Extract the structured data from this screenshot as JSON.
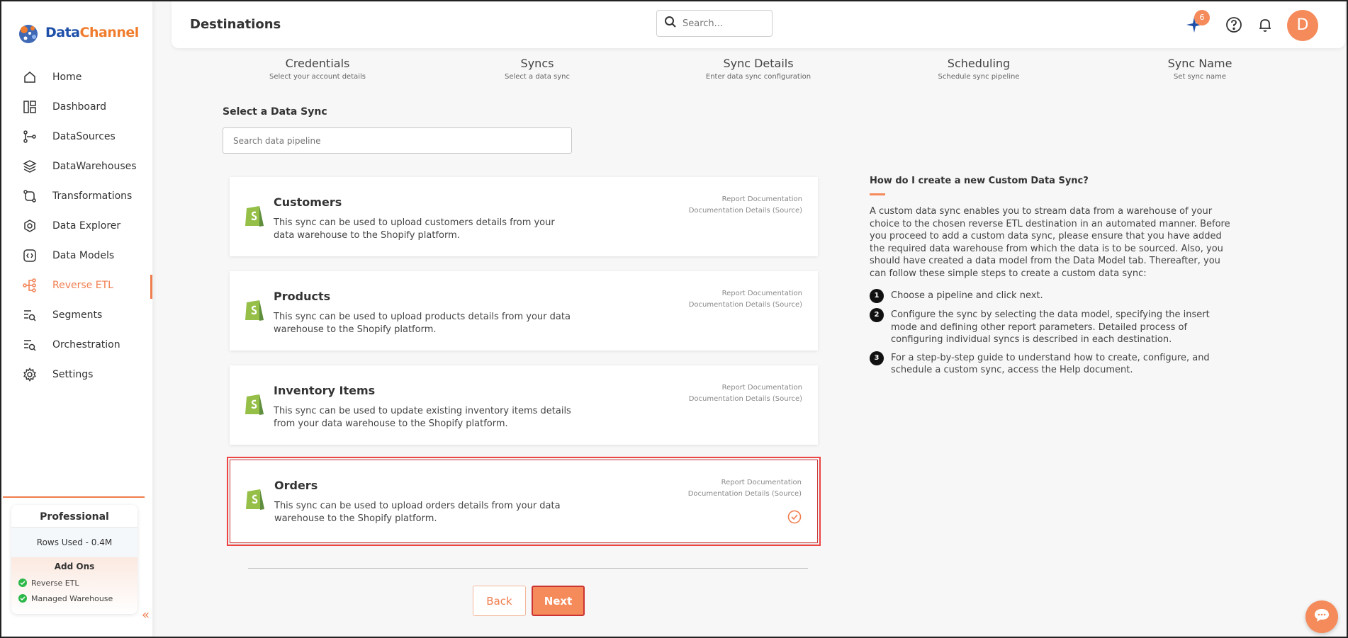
{
  "brand": {
    "part1": "Data",
    "part2": "Channel",
    "primary": "#1e4fa8",
    "accent": "#f07d2e"
  },
  "sidebar": {
    "items": [
      {
        "label": "Home",
        "icon": "home-icon"
      },
      {
        "label": "Dashboard",
        "icon": "dashboard-icon"
      },
      {
        "label": "DataSources",
        "icon": "datasources-icon"
      },
      {
        "label": "DataWarehouses",
        "icon": "layers-icon"
      },
      {
        "label": "Transformations",
        "icon": "transform-icon"
      },
      {
        "label": "Data Explorer",
        "icon": "explorer-icon"
      },
      {
        "label": "Data Models",
        "icon": "models-icon"
      },
      {
        "label": "Reverse ETL",
        "icon": "reverse-etl-icon",
        "active": true
      },
      {
        "label": "Segments",
        "icon": "segments-icon"
      },
      {
        "label": "Orchestration",
        "icon": "orchestration-icon"
      },
      {
        "label": "Settings",
        "icon": "gear-icon"
      }
    ],
    "plan": {
      "title": "Professional",
      "rows_used": "Rows Used - 0.4M",
      "addons_title": "Add Ons",
      "addons": [
        "Reverse ETL",
        "Managed Warehouse"
      ]
    },
    "collapse_glyph": "«"
  },
  "header": {
    "title": "Destinations",
    "search_placeholder": "Search...",
    "notification_count": "6",
    "avatar_initial": "D"
  },
  "steps": [
    {
      "title": "Credentials",
      "sub": "Select your account details"
    },
    {
      "title": "Syncs",
      "sub": "Select a data sync"
    },
    {
      "title": "Sync Details",
      "sub": "Enter data sync configuration"
    },
    {
      "title": "Scheduling",
      "sub": "Schedule sync pipeline"
    },
    {
      "title": "Sync Name",
      "sub": "Set sync name"
    }
  ],
  "main": {
    "section_label": "Select a Data Sync",
    "search_placeholder": "Search data pipeline",
    "report_doc_label": "Report Documentation",
    "details_doc_label": "Documentation Details (Source)",
    "cards": [
      {
        "title": "Customers",
        "desc": "This sync can be used to upload customers details from your data warehouse to the Shopify platform.",
        "selected": false
      },
      {
        "title": "Products",
        "desc": "This sync can be used to upload products details from your data warehouse to the Shopify platform.",
        "selected": false
      },
      {
        "title": "Inventory Items",
        "desc": "This sync can be used to update existing inventory items details from your data warehouse to the Shopify platform.",
        "selected": false
      },
      {
        "title": "Orders",
        "desc": "This sync can be used to upload orders details from your data warehouse to the Shopify platform.",
        "selected": true
      }
    ],
    "back_label": "Back",
    "next_label": "Next"
  },
  "help": {
    "title": "How do I create a new Custom Data Sync?",
    "paragraph": "A custom data sync enables you to stream data from a warehouse of your choice to the chosen reverse ETL destination in an automated manner. Before you proceed to add a custom data sync, please ensure that you have added the required data warehouse from which the data is to be sourced. Also, you should have created a data model from the Data Model tab. Thereafter, you can follow these simple steps to create a custom data sync:",
    "steps": [
      {
        "num": "1",
        "text": "Choose a pipeline and click next."
      },
      {
        "num": "2",
        "text": "Configure the sync by selecting the data model, specifying the insert mode and defining other report parameters. Detailed process of configuring individual syncs is described in each destination."
      },
      {
        "num": "3",
        "text": "For a step-by-step guide to understand how to create, configure, and schedule a custom sync, access the Help document."
      }
    ]
  }
}
